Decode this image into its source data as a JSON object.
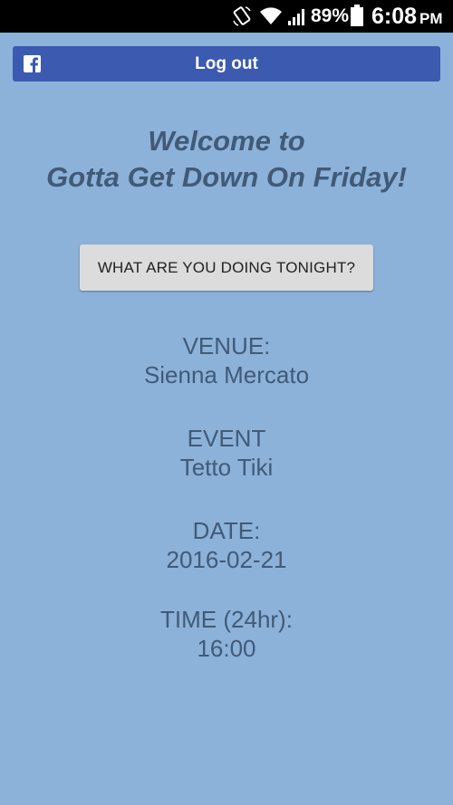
{
  "status_bar": {
    "battery_percent": "89%",
    "time": "6:08",
    "ampm": "PM",
    "icons": [
      "screen-rotate-icon",
      "wifi-icon",
      "signal-icon",
      "battery-icon"
    ]
  },
  "logout": {
    "label": "Log out",
    "icon": "facebook-icon",
    "color": "#3b5ab0"
  },
  "welcome": {
    "line1": "Welcome to",
    "line2": "Gotta Get Down On Friday!"
  },
  "action_button": {
    "label": "WHAT ARE YOU DOING TONIGHT?"
  },
  "details": {
    "venue": {
      "label": "VENUE:",
      "value": "Sienna Mercato"
    },
    "event": {
      "label": "EVENT",
      "value": "Tetto Tiki"
    },
    "date": {
      "label": "DATE:",
      "value": "2016-02-21"
    },
    "time": {
      "label": "TIME (24hr):",
      "value": "16:00"
    }
  },
  "colors": {
    "background": "#8cb2d9",
    "text": "#415a78",
    "facebook_blue": "#3b5ab0"
  }
}
